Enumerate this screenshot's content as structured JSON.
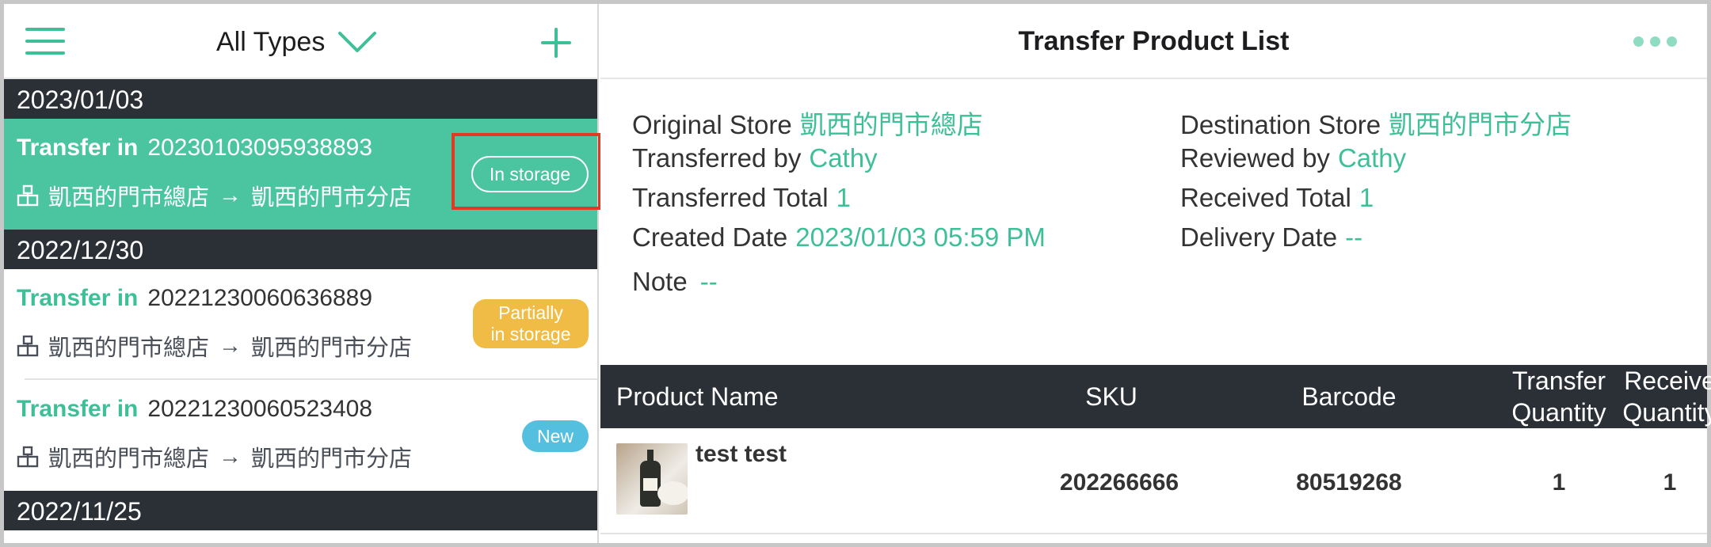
{
  "left_header": {
    "type_filter": "All Types"
  },
  "groups": [
    {
      "date": "2023/01/03",
      "records": [
        {
          "kind": "Transfer in",
          "number": "20230103095938893",
          "from": "凱西的門市總店",
          "arrow": "→",
          "to": "凱西的門市分店",
          "status_line1": "In storage",
          "status_line2": "",
          "active": true
        }
      ]
    },
    {
      "date": "2022/12/30",
      "records": [
        {
          "kind": "Transfer in",
          "number": "20221230060636889",
          "from": "凱西的門市總店",
          "arrow": "→",
          "to": "凱西的門市分店",
          "status_line1": "Partially",
          "status_line2": "in storage",
          "active": false
        },
        {
          "kind": "Transfer in",
          "number": "20221230060523408",
          "from": "凱西的門市總店",
          "arrow": "→",
          "to": "凱西的門市分店",
          "status_line1": "New",
          "status_line2": "",
          "active": false
        }
      ]
    },
    {
      "date": "2022/11/25",
      "records": []
    }
  ],
  "detail": {
    "title": "Transfer Product List",
    "original_store_label": "Original Store",
    "original_store": "凱西的門市總店",
    "destination_store_label": "Destination Store",
    "destination_store": "凱西的門市分店",
    "transferred_by_label": "Transferred by",
    "transferred_by": "Cathy",
    "reviewed_by_label": "Reviewed by",
    "reviewed_by": "Cathy",
    "transferred_total_label": "Transferred Total",
    "transferred_total": "1",
    "received_total_label": "Received Total",
    "received_total": "1",
    "created_date_label": "Created Date",
    "created_date": "2023/01/03 05:59 PM",
    "delivery_date_label": "Delivery Date",
    "delivery_date": "--",
    "note_label": "Note",
    "note": "--"
  },
  "table": {
    "headers": {
      "product_name": "Product Name",
      "sku": "SKU",
      "barcode": "Barcode",
      "transfer_qty_1": "Transfer",
      "transfer_qty_2": "Quantity",
      "receive_qty_1": "Receive",
      "receive_qty_2": "Quantity"
    },
    "rows": [
      {
        "product_name": "test test",
        "sku": "202266666",
        "barcode": "80519268",
        "transfer_qty": "1",
        "receive_qty": "1"
      }
    ]
  },
  "colors": {
    "accent": "#3fbf98",
    "active_row": "#4bc5a0",
    "dark_header": "#2b2f36",
    "partial_badge": "#f1bc45",
    "new_badge": "#55bfe0",
    "highlight": "#e03a22"
  }
}
